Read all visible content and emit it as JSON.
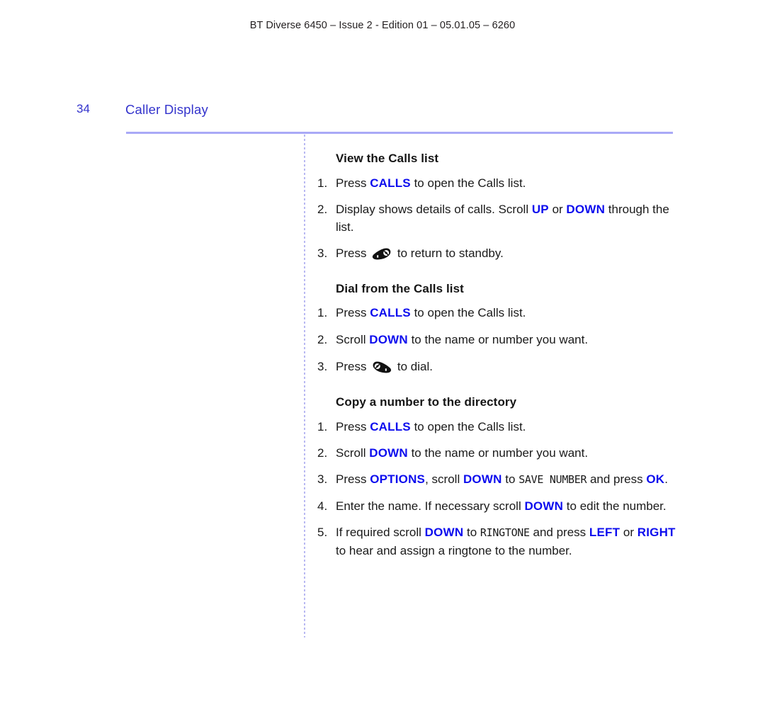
{
  "header": {
    "running_head": "BT Diverse 6450 – Issue 2 - Edition 01 – 05.01.05 – 6260"
  },
  "page": {
    "number": "34",
    "title": "Caller Display",
    "title_color": "#3333cc",
    "rule_color": "#a9a9f7",
    "key_color": "#0d0dee"
  },
  "sections": [
    {
      "heading": "View the Calls list",
      "steps": [
        {
          "num": "1.",
          "parts": [
            {
              "type": "text",
              "value": "Press "
            },
            {
              "type": "key",
              "value": "CALLS"
            },
            {
              "type": "text",
              "value": " to open the Calls list."
            }
          ]
        },
        {
          "num": "2.",
          "parts": [
            {
              "type": "text",
              "value": "Display shows details of calls. Scroll "
            },
            {
              "type": "key",
              "value": "UP"
            },
            {
              "type": "text",
              "value": " or "
            },
            {
              "type": "key",
              "value": "DOWN"
            },
            {
              "type": "text",
              "value": " through the list."
            }
          ]
        },
        {
          "num": "3.",
          "parts": [
            {
              "type": "text",
              "value": "Press "
            },
            {
              "type": "icon",
              "value": "end-call-handset-icon"
            },
            {
              "type": "text",
              "value": " to return to standby."
            }
          ]
        }
      ]
    },
    {
      "heading": "Dial from the Calls list",
      "steps": [
        {
          "num": "1.",
          "parts": [
            {
              "type": "text",
              "value": "Press "
            },
            {
              "type": "key",
              "value": "CALLS"
            },
            {
              "type": "text",
              "value": " to open the Calls list."
            }
          ]
        },
        {
          "num": "2.",
          "parts": [
            {
              "type": "text",
              "value": "Scroll "
            },
            {
              "type": "key",
              "value": "DOWN"
            },
            {
              "type": "text",
              "value": " to the name or number you want."
            }
          ]
        },
        {
          "num": "3.",
          "parts": [
            {
              "type": "text",
              "value": "Press "
            },
            {
              "type": "icon",
              "value": "dial-handset-icon"
            },
            {
              "type": "text",
              "value": " to dial."
            }
          ]
        }
      ]
    },
    {
      "heading": "Copy a number to the directory",
      "steps": [
        {
          "num": "1.",
          "parts": [
            {
              "type": "text",
              "value": "Press "
            },
            {
              "type": "key",
              "value": "CALLS"
            },
            {
              "type": "text",
              "value": " to open the Calls list."
            }
          ]
        },
        {
          "num": "2.",
          "parts": [
            {
              "type": "text",
              "value": "Scroll "
            },
            {
              "type": "key",
              "value": "DOWN"
            },
            {
              "type": "text",
              "value": " to the name or number you want."
            }
          ]
        },
        {
          "num": "3.",
          "parts": [
            {
              "type": "text",
              "value": "Press "
            },
            {
              "type": "key",
              "value": "OPTIONS"
            },
            {
              "type": "text",
              "value": ", scroll "
            },
            {
              "type": "key",
              "value": "DOWN"
            },
            {
              "type": "text",
              "value": " to "
            },
            {
              "type": "lcd",
              "value": "SAVE NUMBER"
            },
            {
              "type": "text",
              "value": " and press "
            },
            {
              "type": "key",
              "value": "OK"
            },
            {
              "type": "text",
              "value": "."
            }
          ]
        },
        {
          "num": "4.",
          "parts": [
            {
              "type": "text",
              "value": "Enter the name. If necessary scroll "
            },
            {
              "type": "key",
              "value": "DOWN"
            },
            {
              "type": "text",
              "value": " to edit the number."
            }
          ]
        },
        {
          "num": "5.",
          "parts": [
            {
              "type": "text",
              "value": "If required scroll "
            },
            {
              "type": "key",
              "value": "DOWN"
            },
            {
              "type": "text",
              "value": " to "
            },
            {
              "type": "lcd",
              "value": "RINGTONE"
            },
            {
              "type": "text",
              "value": " and press "
            },
            {
              "type": "key",
              "value": "LEFT"
            },
            {
              "type": "text",
              "value": " or "
            },
            {
              "type": "key",
              "value": "RIGHT"
            },
            {
              "type": "text",
              "value": " to hear and assign a ringtone to the number."
            }
          ]
        }
      ]
    }
  ]
}
